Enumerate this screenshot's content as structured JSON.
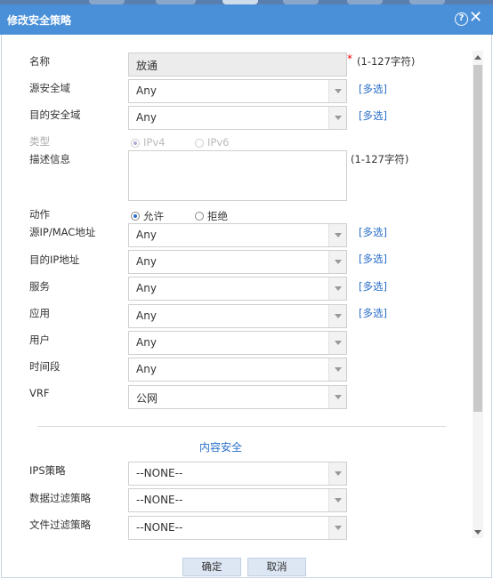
{
  "dialog": {
    "title": "修改安全策略",
    "help_icon": "help-icon",
    "close_icon": "close-icon",
    "title_bg": "#4a90d9"
  },
  "form": {
    "name_label": "名称",
    "name_value": "放通",
    "required_mark": "*",
    "name_hint": "(1-127字符)",
    "src_zone_label": "源安全域",
    "src_zone_value": "Any",
    "src_zone_link": "[多选]",
    "dst_zone_label": "目的安全域",
    "dst_zone_value": "Any",
    "dst_zone_link": "[多选]",
    "type_label": "类型",
    "type_ipv4": "IPv4",
    "type_ipv6": "IPv6",
    "desc_label": "描述信息",
    "desc_hint": "(1-127字符)",
    "desc_value": "",
    "action_label": "动作",
    "action_permit": "允许",
    "action_deny": "拒绝",
    "src_addr_label": "源IP/MAC地址",
    "src_addr_value": "Any",
    "src_addr_link": "[多选]",
    "dst_addr_label": "目的IP地址",
    "dst_addr_value": "Any",
    "dst_addr_link": "[多选]",
    "service_label": "服务",
    "service_value": "Any",
    "service_link": "[多选]",
    "app_label": "应用",
    "app_value": "Any",
    "app_link": "[多选]",
    "user_label": "用户",
    "user_value": "Any",
    "time_label": "时间段",
    "time_value": "Any",
    "vrf_label": "VRF",
    "vrf_value": "公网"
  },
  "content_security": {
    "section_title": "内容安全",
    "ips_label": "IPS策略",
    "ips_value": "--NONE--",
    "data_filter_label": "数据过滤策略",
    "data_filter_value": "--NONE--",
    "file_filter_label": "文件过滤策略",
    "file_filter_value": "--NONE--"
  },
  "buttons": {
    "ok": "确定",
    "cancel": "取消"
  },
  "colors": {
    "link": "#2a6fc9",
    "required": "#e00000"
  }
}
